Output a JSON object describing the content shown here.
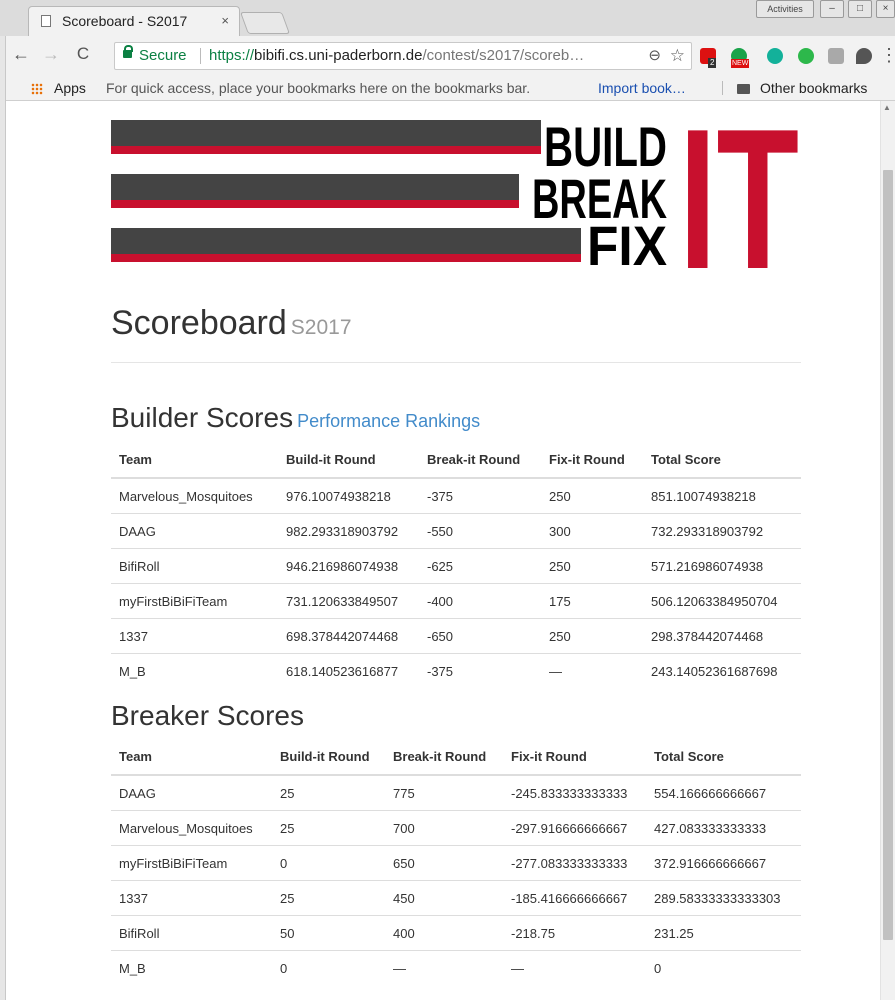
{
  "browser": {
    "tab_title": "Scoreboard - S2017",
    "tab_close": "×",
    "secure_label": "Secure",
    "url_scheme": "https://",
    "url_host": "bibifi.cs.uni-paderborn.de",
    "url_path": "/contest/s2017/scoreb…",
    "extension_badges": [
      "2",
      "NEW"
    ],
    "window_controls": [
      "Activities"
    ]
  },
  "bookmarks_bar": {
    "apps_label": "Apps",
    "hint": "For quick access, place your bookmarks here on the bookmarks bar.",
    "import_link": "Import book…",
    "other_bookmarks": "Other bookmarks"
  },
  "logo": {
    "words": [
      "BUILD",
      "BREAK",
      "FIX"
    ],
    "big_letters": "IT",
    "colors": {
      "dark": "#444444",
      "red": "#c8102e",
      "black": "#000000"
    }
  },
  "page": {
    "title": "Scoreboard",
    "subtitle": "S2017"
  },
  "builder": {
    "heading": "Builder Scores",
    "link": "Performance Rankings",
    "columns": [
      "Team",
      "Build-it Round",
      "Break-it Round",
      "Fix-it Round",
      "Total Score"
    ],
    "rows": [
      [
        "Marvelous_Mosquitoes",
        "976.10074938218",
        "-375",
        "250",
        "851.10074938218"
      ],
      [
        "DAAG",
        "982.293318903792",
        "-550",
        "300",
        "732.293318903792"
      ],
      [
        "BifiRoll",
        "946.216986074938",
        "-625",
        "250",
        "571.216986074938"
      ],
      [
        "myFirstBiBiFiTeam",
        "731.120633849507",
        "-400",
        "175",
        "506.12063384950704"
      ],
      [
        "1337",
        "698.378442074468",
        "-650",
        "250",
        "298.378442074468"
      ],
      [
        "M_B",
        "618.140523616877",
        "-375",
        "—",
        "243.14052361687698"
      ]
    ]
  },
  "breaker": {
    "heading": "Breaker Scores",
    "columns": [
      "Team",
      "Build-it Round",
      "Break-it Round",
      "Fix-it Round",
      "Total Score"
    ],
    "rows": [
      [
        "DAAG",
        "25",
        "775",
        "-245.833333333333",
        "554.166666666667"
      ],
      [
        "Marvelous_Mosquitoes",
        "25",
        "700",
        "-297.916666666667",
        "427.083333333333"
      ],
      [
        "myFirstBiBiFiTeam",
        "0",
        "650",
        "-277.083333333333",
        "372.916666666667"
      ],
      [
        "1337",
        "25",
        "450",
        "-185.416666666667",
        "289.58333333333303"
      ],
      [
        "BifiRoll",
        "50",
        "400",
        "-218.75",
        "231.25"
      ],
      [
        "M_B",
        "0",
        "—",
        "—",
        "0"
      ]
    ]
  }
}
